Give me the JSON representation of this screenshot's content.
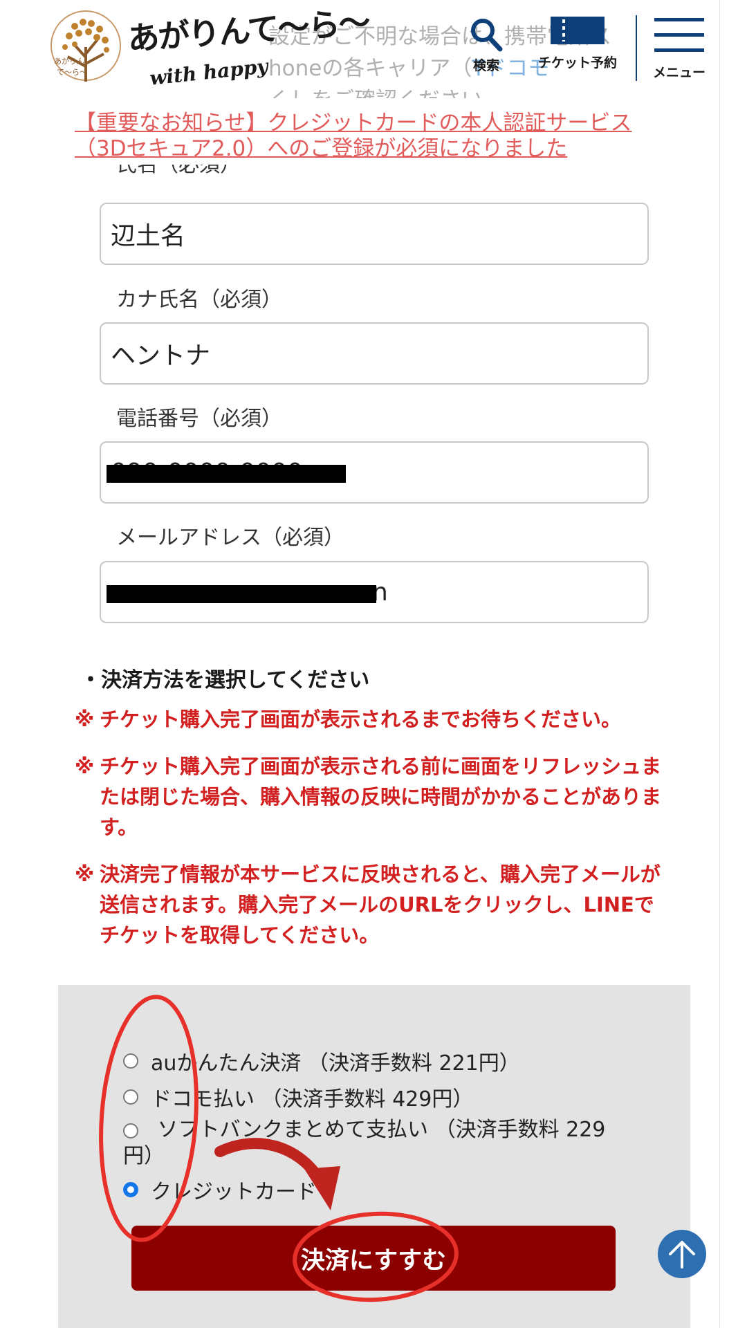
{
  "header": {
    "logo_text": "あがりんて〜ら〜",
    "logo_sub": "with happy",
    "background_notice_lines": [
      "設定がご不明な場合は、携帯電話ス",
      "honeの各キャリア（",
      "くしをご確認ください"
    ],
    "background_notice_link": "Tドコモ",
    "search_label": "検索",
    "ticket_label": "チケット予約",
    "menu_label": "メニュー",
    "accent_color": "#0e3f78"
  },
  "notice": {
    "line1": "【重要なお知らせ】クレジットカードの本人認証サービス",
    "line2": "（3Dセキュア2.0）へのご登録が必須になりました"
  },
  "form": {
    "name_label_cut": "氏名（必須）",
    "name_value": "辺土名",
    "kana_label": "カナ氏名（必須）",
    "kana_value": "ヘントナ",
    "phone_label": "電話番号（必須）",
    "phone_value": "090-0000-0000",
    "email_label": "メールアドレス（必須）",
    "email_value_visible_tail": "n"
  },
  "payment": {
    "heading": "・決済方法を選択してください",
    "warnings": [
      "チケット購入完了画面が表示されるまでお待ちください。",
      "チケット購入完了画面が表示される前に画面をリフレッシュまたは閉じた場合、購入情報の反映に時間がかかることがあります。",
      "決済完了情報が本サービスに反映されると、購入完了メールが送信されます。購入完了メールのURLをクリックし、LINEでチケットを取得してください。"
    ],
    "warning_mark": "※",
    "options": [
      {
        "label": "auかんたん決済 （決済手数料 221円）",
        "checked": false
      },
      {
        "label": "ドコモ払い （決済手数料 429円）",
        "checked": false
      },
      {
        "label": "ソフトバンクまとめて支払い （決済手数料 229円）",
        "checked": false
      },
      {
        "label": "クレジットカード",
        "checked": true
      }
    ],
    "submit_label": "決済にすすむ",
    "submit_color": "#8c0000",
    "radio_color": "#1476e8"
  },
  "annotation_color": "#e8302a"
}
